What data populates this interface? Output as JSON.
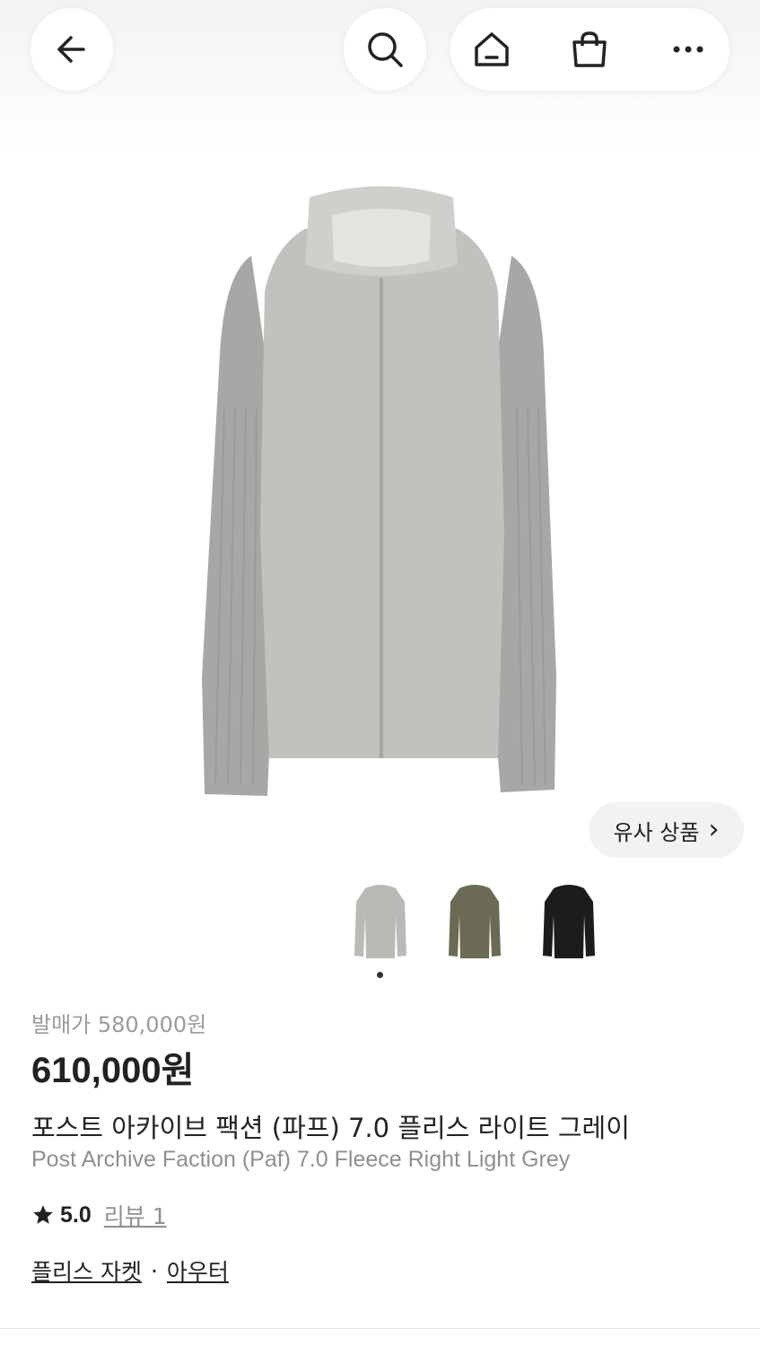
{
  "header": {
    "back_icon": "arrow-left-icon",
    "search_icon": "search-icon",
    "home_icon": "home-icon",
    "cart_icon": "shopping-bag-icon",
    "more_icon": "more-dots-icon"
  },
  "hero": {
    "similar_button_label": "유사 상품",
    "similar_chevron": "›"
  },
  "thumbnails": [
    {
      "color_name": "light grey",
      "color": "#b9bab6"
    },
    {
      "color_name": "olive",
      "color": "#6b6a55"
    },
    {
      "color_name": "black",
      "color": "#1c1c1c"
    }
  ],
  "product": {
    "release_price": "발매가 580,000원",
    "price": "610,000원",
    "name_ko": "포스트 아카이브 팩션 (파프) 7.0 플리스 라이트 그레이",
    "name_en": "Post Archive Faction (Paf) 7.0 Fleece Right Light Grey",
    "rating": "5.0",
    "review_label": "리뷰 1",
    "category_1": "플리스 자켓",
    "separator": "·",
    "category_2": "아우터"
  }
}
